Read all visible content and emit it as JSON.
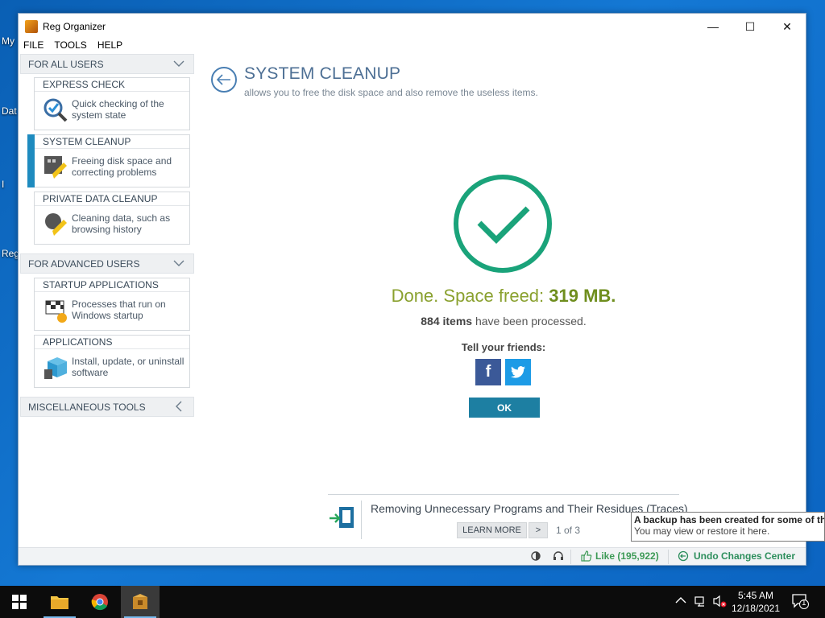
{
  "desktop": {
    "labels": [
      "My",
      "Dat",
      "I",
      "Reg"
    ]
  },
  "window": {
    "title": "Reg Organizer",
    "controls": {
      "minimize": "—",
      "maximize": "☐",
      "close": "✕"
    }
  },
  "menu": [
    "FILE",
    "TOOLS",
    "HELP"
  ],
  "sidebar": {
    "for_all_users": "FOR ALL USERS",
    "cards_all": [
      {
        "title": "EXPRESS CHECK",
        "desc": "Quick checking of the system state",
        "icon": "magnifier-check-icon"
      },
      {
        "title": "SYSTEM CLEANUP",
        "desc": "Freeing disk space and correcting problems",
        "icon": "disk-broom-icon"
      },
      {
        "title": "PRIVATE DATA CLEANUP",
        "desc": "Cleaning data, such as browsing history",
        "icon": "private-broom-icon"
      }
    ],
    "for_advanced_users": "FOR ADVANCED USERS",
    "cards_advanced": [
      {
        "title": "STARTUP APPLICATIONS",
        "desc": "Processes that run on Windows startup",
        "icon": "startup-flag-icon"
      },
      {
        "title": "APPLICATIONS",
        "desc": "Install, update, or uninstall software",
        "icon": "box-trash-icon"
      }
    ],
    "misc_tools": "MISCELLANEOUS TOOLS"
  },
  "main": {
    "title": "SYSTEM CLEANUP",
    "subtitle": "allows you to free the disk space and also remove the useless items.",
    "done_prefix": "Done. Space freed: ",
    "space_freed": "319 MB.",
    "items_count": "884 items",
    "items_suffix": " have been processed.",
    "tell_friends": "Tell your friends:",
    "ok": "OK"
  },
  "tip": {
    "text": "Removing Unnecessary Programs and Their Residues (Traces)",
    "learn_more": "LEARN MORE",
    "next": ">",
    "page": "1 of 3"
  },
  "tooltip": {
    "title": "A backup has been created for some of the",
    "body": "You may view or restore it here."
  },
  "status": {
    "like": "Like (195,922)",
    "undo": "Undo Changes Center"
  },
  "taskbar": {
    "time": "5:45 AM",
    "date": "12/18/2021",
    "notifications": "1"
  },
  "colors": {
    "accent": "#1e8bbf",
    "success": "#1aa37a",
    "ok_button": "#1d7fa2",
    "facebook": "#3b5998",
    "twitter": "#1d9be6"
  }
}
